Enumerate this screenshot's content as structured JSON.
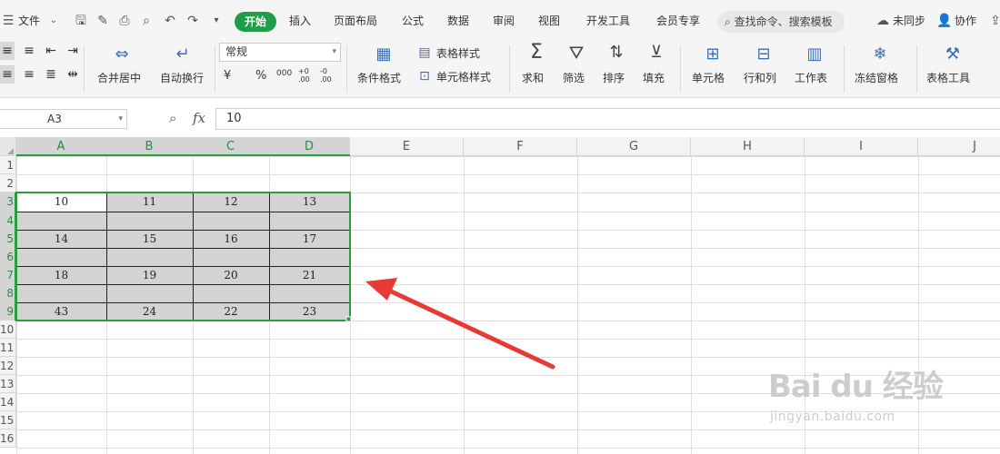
{
  "menu": {
    "file_label": "文件",
    "tabs": [
      "插入",
      "页面布局",
      "公式",
      "数据",
      "审阅",
      "视图",
      "开发工具",
      "会员专享"
    ],
    "active_tab": "开始",
    "search_placeholder": "查找命令、搜索模板",
    "sync_label": "未同步",
    "collab_label": "协作"
  },
  "ribbon": {
    "merge_center": "合并居中",
    "auto_wrap": "自动换行",
    "number_format": "常规",
    "currency_symbol": "¥",
    "percent_symbol": "%",
    "thousand_symbol": "000",
    "dec_increase": "+0 .00",
    "dec_decrease": "-0 .00",
    "conditional_format": "条件格式",
    "table_style": "表格样式",
    "cell_style": "单元格样式",
    "sum": "求和",
    "filter": "筛选",
    "sort": "排序",
    "fill": "填充",
    "cell": "单元格",
    "row_col": "行和列",
    "worksheet": "工作表",
    "freeze": "冻结窗格",
    "table_tools": "表格工具"
  },
  "formula_bar": {
    "cell_ref": "A3",
    "fx_label": "fx",
    "value": "10"
  },
  "columns": [
    "A",
    "B",
    "C",
    "D",
    "E",
    "F",
    "G",
    "H",
    "I",
    "J"
  ],
  "rows": [
    "1",
    "2",
    "3",
    "4",
    "5",
    "6",
    "7",
    "8",
    "9",
    "10",
    "11",
    "12",
    "13",
    "14",
    "15",
    "16"
  ],
  "cells": {
    "r3": [
      "10",
      "11",
      "12",
      "13"
    ],
    "r5": [
      "14",
      "15",
      "16",
      "17"
    ],
    "r7": [
      "18",
      "19",
      "20",
      "21"
    ],
    "r9": [
      "43",
      "24",
      "22",
      "23"
    ]
  },
  "colors": {
    "accent": "#1e9e4a",
    "selection_border": "#2a9d40",
    "selected_fill": "#d3d3d3",
    "arrow": "#e83a35"
  },
  "watermark": {
    "brand": "Bai du 经验",
    "url": "jingyan.baidu.com"
  }
}
